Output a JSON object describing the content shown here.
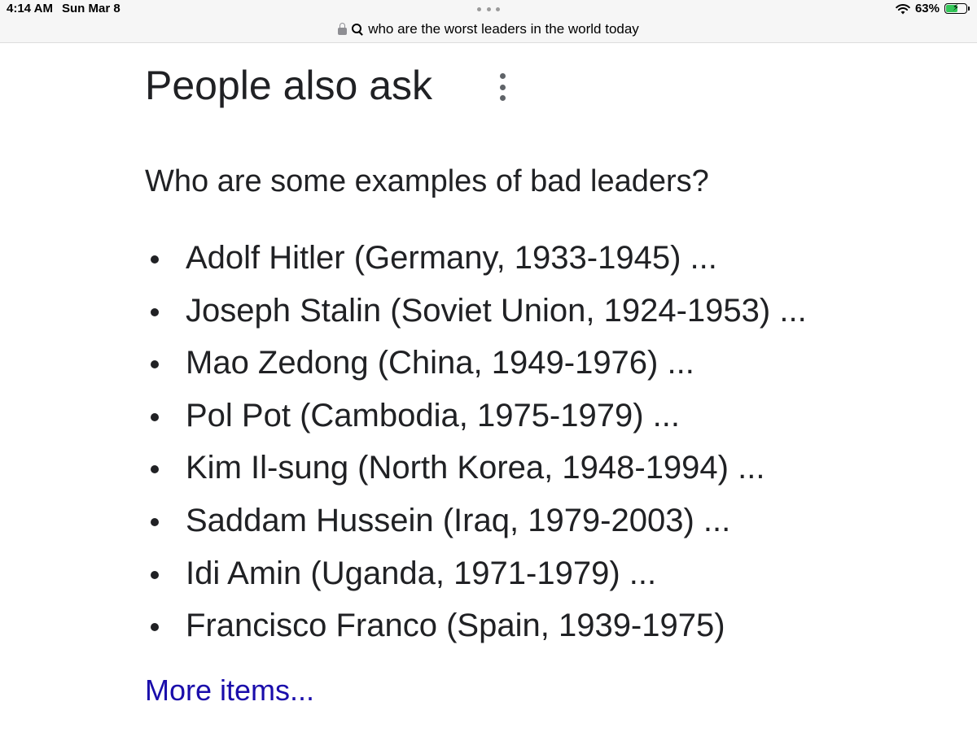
{
  "status_bar": {
    "time": "4:14 AM",
    "date": "Sun Mar 8",
    "battery_percent": "63%",
    "battery_level": 0.63,
    "wifi_icon": "wifi-icon",
    "battery_icon": "battery-charging-icon"
  },
  "url_bar": {
    "query": "who are the worst leaders in the world today",
    "lock_icon": "lock-icon",
    "search_icon": "search-icon"
  },
  "people_also_ask": {
    "title": "People also ask",
    "menu_icon": "more-vert-icon",
    "question": "Who are some examples of bad leaders?",
    "items": [
      "Adolf Hitler (Germany, 1933-1945) ...",
      "Joseph Stalin (Soviet Union, 1924-1953) ...",
      "Mao Zedong (China, 1949-1976) ...",
      "Pol Pot (Cambodia, 1975-1979) ...",
      "Kim Il-sung (North Korea, 1948-1994) ...",
      "Saddam Hussein (Iraq, 1979-2003) ...",
      "Idi Amin (Uganda, 1971-1979) ...",
      "Francisco Franco (Spain, 1939-1975)"
    ],
    "more_link": "More items..."
  },
  "colors": {
    "link": "#1a0dab",
    "text": "#202124",
    "battery_charging": "#34c759"
  }
}
